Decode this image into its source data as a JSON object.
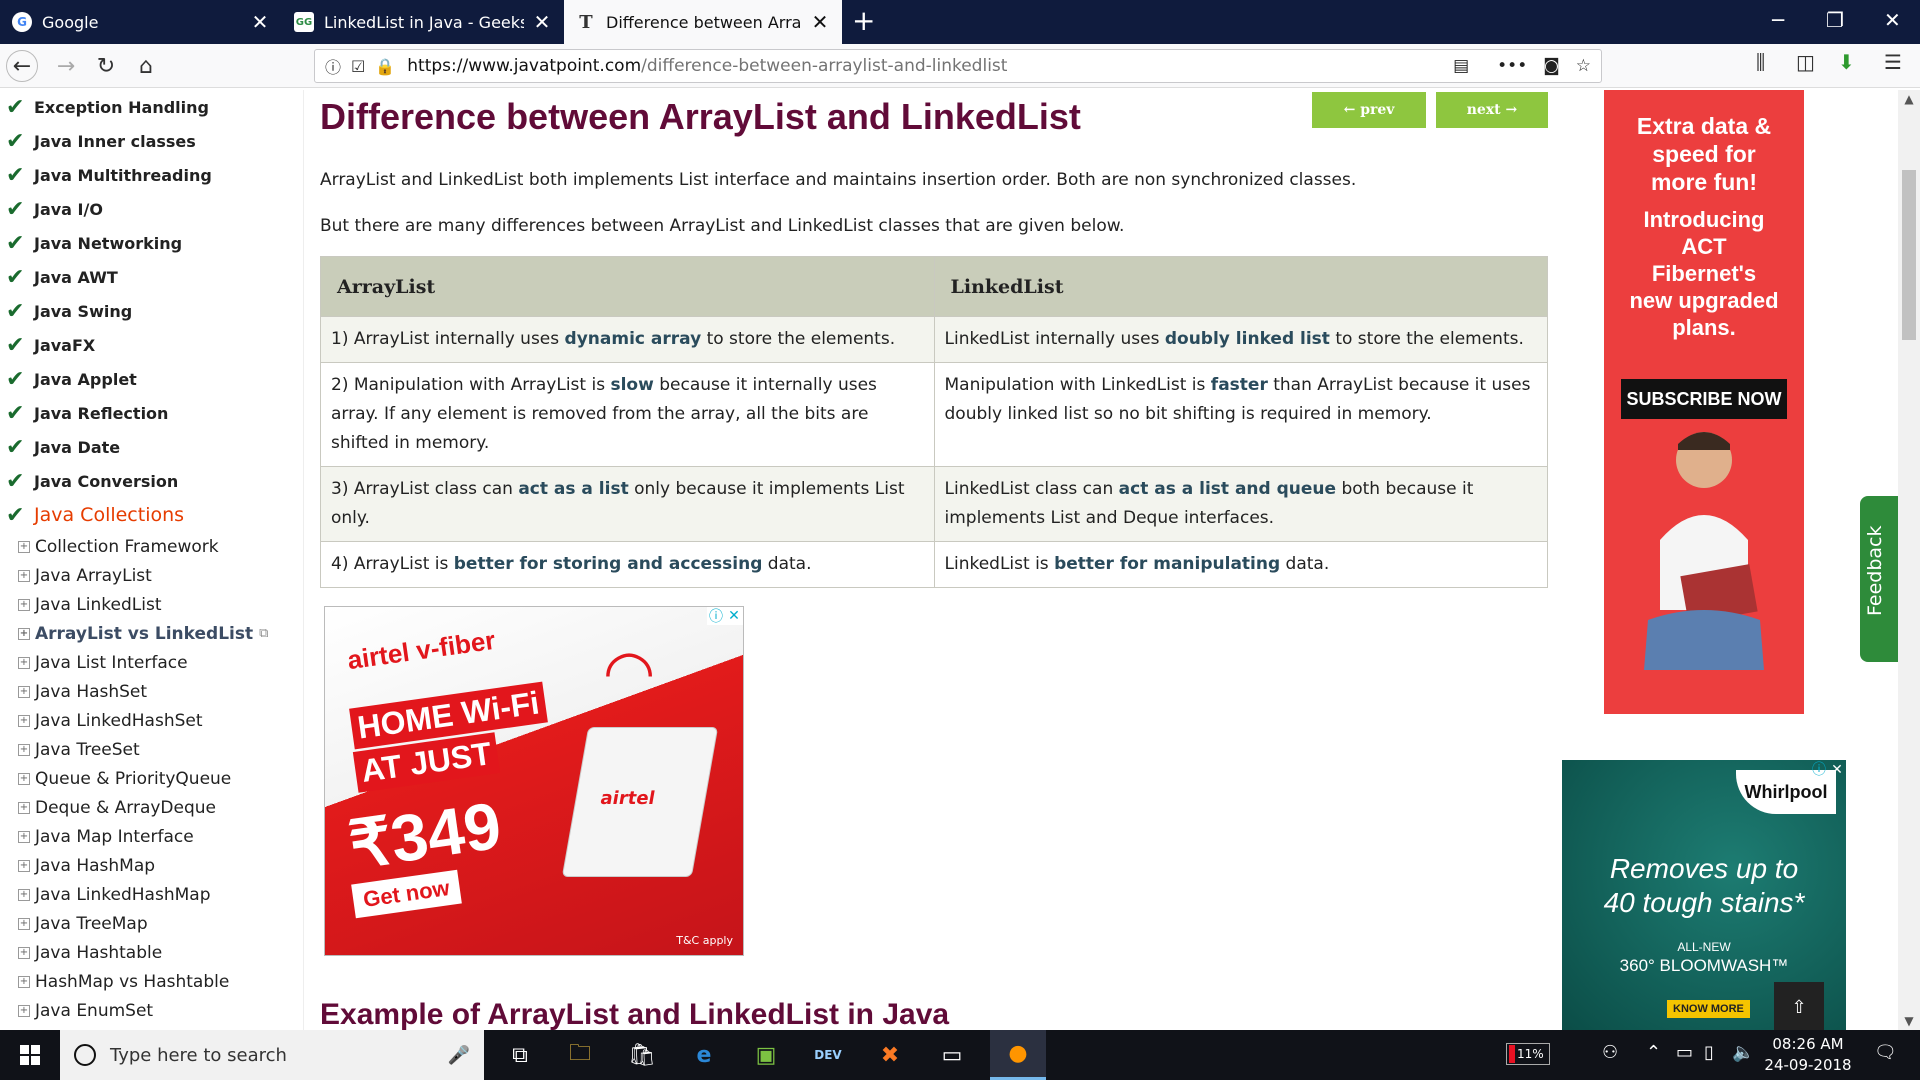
{
  "browser": {
    "tabs": [
      {
        "title": "Google",
        "favicon": "google-g-icon",
        "active": false
      },
      {
        "title": "LinkedList in Java - GeeksforGe",
        "favicon": "gfg-icon",
        "active": false
      },
      {
        "title": "Difference between ArrayList a",
        "favicon": "javatpoint-icon",
        "active": true
      }
    ],
    "url_host": "https://www.javatpoint.com",
    "url_path": "/difference-between-arraylist-and-linkedlist"
  },
  "sidebar": {
    "topics": [
      "Exception Handling",
      "Java Inner classes",
      "Java Multithreading",
      "Java I/O",
      "Java Networking",
      "Java AWT",
      "Java Swing",
      "JavaFX",
      "Java Applet",
      "Java Reflection",
      "Java Date",
      "Java Conversion"
    ],
    "current_topic": "Java Collections",
    "subtopics": [
      "Collection Framework",
      "Java ArrayList",
      "Java LinkedList",
      "ArrayList vs LinkedList",
      "Java List Interface",
      "Java HashSet",
      "Java LinkedHashSet",
      "Java TreeSet",
      "Queue & PriorityQueue",
      "Deque & ArrayDeque",
      "Java Map Interface",
      "Java HashMap",
      "Java LinkedHashMap",
      "Java TreeMap",
      "Java Hashtable",
      "HashMap vs Hashtable",
      "Java EnumSet"
    ],
    "current_subtopic_index": 3
  },
  "main": {
    "title": "Difference between ArrayList and LinkedList",
    "prev_label": "← prev",
    "next_label": "next →",
    "intro1": "ArrayList and LinkedList both implements List interface and maintains insertion order. Both are non synchronized classes.",
    "intro2": "But there are many differences between ArrayList and LinkedList classes that are given below.",
    "table": {
      "headers": [
        "ArrayList",
        "LinkedList"
      ],
      "rows": [
        [
          [
            "1) ArrayList internally uses ",
            "dynamic array",
            " to store the elements."
          ],
          [
            "LinkedList internally uses ",
            "doubly linked list",
            " to store the elements."
          ]
        ],
        [
          [
            "2) Manipulation with ArrayList is ",
            "slow",
            " because it internally uses array. If any element is removed from the array, all the bits are shifted in memory."
          ],
          [
            "Manipulation with LinkedList is ",
            "faster",
            " than ArrayList because it uses doubly linked list so no bit shifting is required in memory."
          ]
        ],
        [
          [
            "3) ArrayList class can ",
            "act as a list",
            " only because it implements List only."
          ],
          [
            "LinkedList class can ",
            "act as a list and queue",
            " both because it implements List and Deque interfaces."
          ]
        ],
        [
          [
            "4) ArrayList is ",
            "better for storing and accessing",
            " data."
          ],
          [
            "LinkedList is ",
            "better for manipulating",
            " data."
          ]
        ]
      ]
    },
    "example_title": "Example of ArrayList and LinkedList in Java"
  },
  "ads": {
    "airtel": {
      "brand": "airtel v-fiber",
      "line1": "HOME Wi-Fi",
      "line2": "AT JUST",
      "price": "₹349",
      "cta": "Get now",
      "router_brand": "airtel",
      "tc": "T&C apply"
    },
    "act": {
      "headline": "Extra data & speed for more fun!",
      "subline": "Introducing ACT Fibernet's new upgraded plans.",
      "button": "SUBSCRIBE NOW"
    },
    "whirlpool": {
      "logo": "Whirlpool",
      "message": "Removes up to 40 tough stains*",
      "sub1": "ALL-NEW",
      "sub2": "360° BLOOMWASH™",
      "cta": "KNOW MORE"
    }
  },
  "feedback_label": "Feedback",
  "taskbar": {
    "search_placeholder": "Type here to search",
    "battery": "11%",
    "time": "08:26 AM",
    "date": "24-09-2018"
  },
  "colors": {
    "title": "#610b38",
    "nav_button": "#8ec63f",
    "table_header": "#c9cdba",
    "act_ad": "#ec3e3e",
    "tabbar": "#0f1b3d"
  }
}
